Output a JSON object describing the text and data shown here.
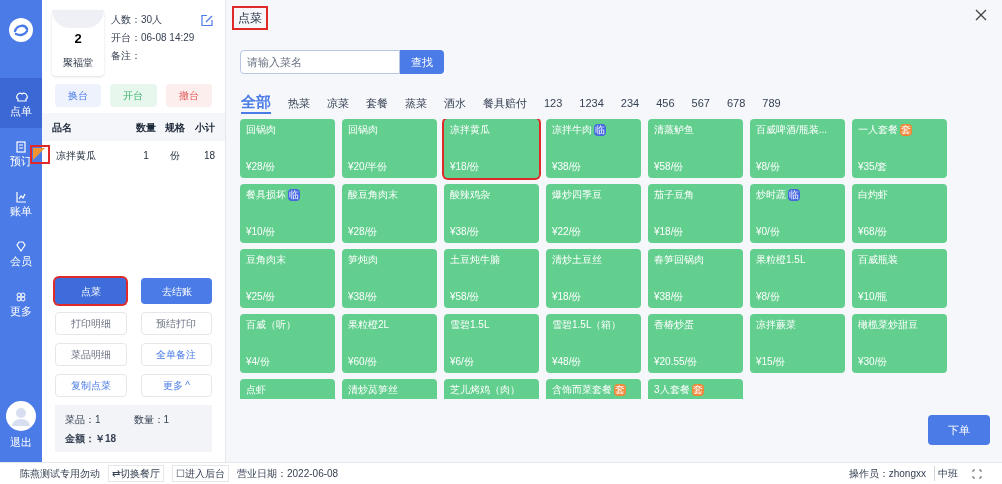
{
  "nav": {
    "items": [
      {
        "label": "点单",
        "selected": true
      },
      {
        "label": "预订",
        "selected": false
      },
      {
        "label": "账单",
        "selected": false
      },
      {
        "label": "会员",
        "selected": false
      },
      {
        "label": "更多",
        "selected": false
      }
    ],
    "logout": "退出"
  },
  "table": {
    "number": "2",
    "name": "聚福堂",
    "people": "人数：30人",
    "opened": "开台：06-08 14:29",
    "note": "备注："
  },
  "table_actions": [
    {
      "label": "换台",
      "kind": "blue"
    },
    {
      "label": "开台",
      "kind": "green"
    },
    {
      "label": "撤台",
      "kind": "red"
    }
  ],
  "order": {
    "columns": [
      "品名",
      "数量",
      "规格",
      "小计"
    ],
    "rows": [
      {
        "cells": [
          "凉拌黄瓜",
          "1",
          "份",
          "18"
        ],
        "flagged": true
      }
    ]
  },
  "main_buttons": [
    {
      "label": "点菜",
      "selected": true,
      "highlighted": true
    },
    {
      "label": "去结账",
      "selected": false,
      "highlighted": false
    }
  ],
  "more_buttons": [
    {
      "label": "打印明细",
      "disabled": true
    },
    {
      "label": "预结打印",
      "disabled": true
    },
    {
      "label": "菜品明细",
      "disabled": true
    },
    {
      "label": "全单备注",
      "disabled": false
    },
    {
      "label": "复制点菜",
      "disabled": false
    },
    {
      "label": "更多 ^",
      "disabled": false
    }
  ],
  "summary": {
    "dishes": "菜品：1",
    "quantity": "数量：1",
    "amount": "金额：￥18"
  },
  "dialog": {
    "title": "点菜",
    "title_highlighted": true,
    "search": {
      "placeholder": "请输入菜名"
    },
    "search_button": "查找",
    "tabs": [
      {
        "label": "全部",
        "selected": true
      },
      {
        "label": "热菜",
        "selected": false
      },
      {
        "label": "凉菜",
        "selected": false
      },
      {
        "label": "套餐",
        "selected": false
      },
      {
        "label": "蒸菜",
        "selected": false
      },
      {
        "label": "酒水",
        "selected": false
      },
      {
        "label": "餐具赔付",
        "selected": false
      },
      {
        "label": "123",
        "selected": false
      },
      {
        "label": "1234",
        "selected": false
      },
      {
        "label": "234",
        "selected": false
      },
      {
        "label": "456",
        "selected": false
      },
      {
        "label": "567",
        "selected": false
      },
      {
        "label": "678",
        "selected": false
      },
      {
        "label": "789",
        "selected": false
      }
    ],
    "dishes": [
      {
        "name": "回锅肉",
        "price": "¥28/份",
        "highlighted": false
      },
      {
        "name": "回锅肉",
        "price": "¥20/半份",
        "highlighted": false
      },
      {
        "name": "凉拌黄瓜",
        "price": "¥18/份",
        "highlighted": true
      },
      {
        "name": "凉拌牛肉",
        "badge": {
          "text": "临",
          "color": "#4466e0"
        },
        "price": "¥38/份",
        "highlighted": false
      },
      {
        "name": "清蒸鲈鱼",
        "price": "¥58/份",
        "highlighted": false
      },
      {
        "name": "百威啤酒/瓶装...",
        "price": "¥8/份",
        "highlighted": false
      },
      {
        "name": "一人套餐",
        "badge": {
          "text": "套",
          "color": "#f0883a"
        },
        "price": "¥35/套",
        "highlighted": false
      },
      {
        "name": "餐具损坏",
        "badge": {
          "text": "临",
          "color": "#4466e0"
        },
        "price": "¥10/份",
        "highlighted": false
      },
      {
        "name": "酸豆角肉末",
        "price": "¥28/份",
        "highlighted": false
      },
      {
        "name": "酸辣鸡杂",
        "price": "¥38/份",
        "highlighted": false
      },
      {
        "name": "爆炒四季豆",
        "price": "¥22/份",
        "highlighted": false
      },
      {
        "name": "茄子豆角",
        "price": "¥18/份",
        "highlighted": false
      },
      {
        "name": "炒时蔬",
        "badge": {
          "text": "临",
          "color": "#4466e0"
        },
        "price": "¥0/份",
        "highlighted": false
      },
      {
        "name": "白灼虾",
        "price": "¥68/份",
        "highlighted": false
      },
      {
        "name": "豆角肉末",
        "price": "¥25/份",
        "highlighted": false
      },
      {
        "name": "笋炖肉",
        "price": "¥38/份",
        "highlighted": false
      },
      {
        "name": "土豆炖牛腩",
        "price": "¥58/份",
        "highlighted": false
      },
      {
        "name": "清炒土豆丝",
        "price": "¥18/份",
        "highlighted": false
      },
      {
        "name": "春笋回锅肉",
        "price": "¥38/份",
        "highlighted": false
      },
      {
        "name": "果粒橙1.5L",
        "price": "¥8/份",
        "highlighted": false
      },
      {
        "name": "百威瓶装",
        "price": "¥10/瓶",
        "highlighted": false
      },
      {
        "name": "百威（听）",
        "price": "¥4/份",
        "highlighted": false
      },
      {
        "name": "果粒橙2L",
        "price": "¥60/份",
        "highlighted": false
      },
      {
        "name": "雪碧1.5L",
        "price": "¥6/份",
        "highlighted": false
      },
      {
        "name": "雪碧1.5L（箱）",
        "price": "¥48/份",
        "highlighted": false
      },
      {
        "name": "香椿炒蛋",
        "price": "¥20.55/份",
        "highlighted": false
      },
      {
        "name": "凉拌蕨菜",
        "price": "¥15/份",
        "highlighted": false
      },
      {
        "name": "橄榄菜炒甜豆",
        "price": "¥30/份",
        "highlighted": false
      },
      {
        "name": "点虾",
        "highlighted": false
      },
      {
        "name": "清炒莴笋丝",
        "highlighted": false
      },
      {
        "name": "芝儿烤鸡（肉）",
        "highlighted": false
      },
      {
        "name": "含饰而菜套餐",
        "badge": {
          "text": "套",
          "color": "#f0883a"
        },
        "highlighted": false
      },
      {
        "name": "3人套餐",
        "badge": {
          "text": "套",
          "color": "#f0883a"
        },
        "highlighted": false
      }
    ],
    "submit": "下单"
  },
  "status_bar": {
    "left": [
      "陈燕测试专用勿动",
      "⇄切换餐厅",
      "☐进入后台",
      "营业日期：2022-06-08"
    ],
    "operator": "操作员：zhongxx",
    "shift": "中班"
  }
}
